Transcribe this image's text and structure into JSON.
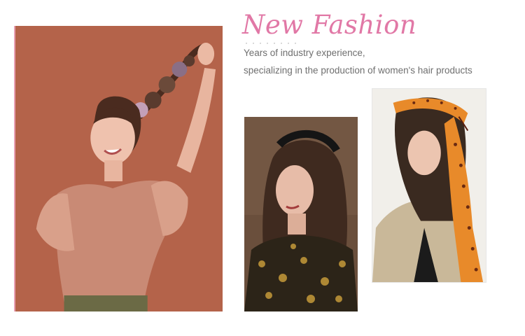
{
  "header": {
    "title": "New Fashion",
    "line1": "Years of industry experience,",
    "line2": "specializing in the production of women's hair products"
  },
  "colors": {
    "title": "#e178a6",
    "body_text": "#6f6f6f",
    "main_photo_bg": "#b9664c"
  },
  "images": [
    {
      "subject": "smiling woman in a pink top holding a braid decorated with satin scrunchies above her head"
    },
    {
      "subject": "woman with a dark jeweled headband and patterned blouse"
    },
    {
      "subject": "woman wearing an orange printed silk scarf headband"
    }
  ]
}
